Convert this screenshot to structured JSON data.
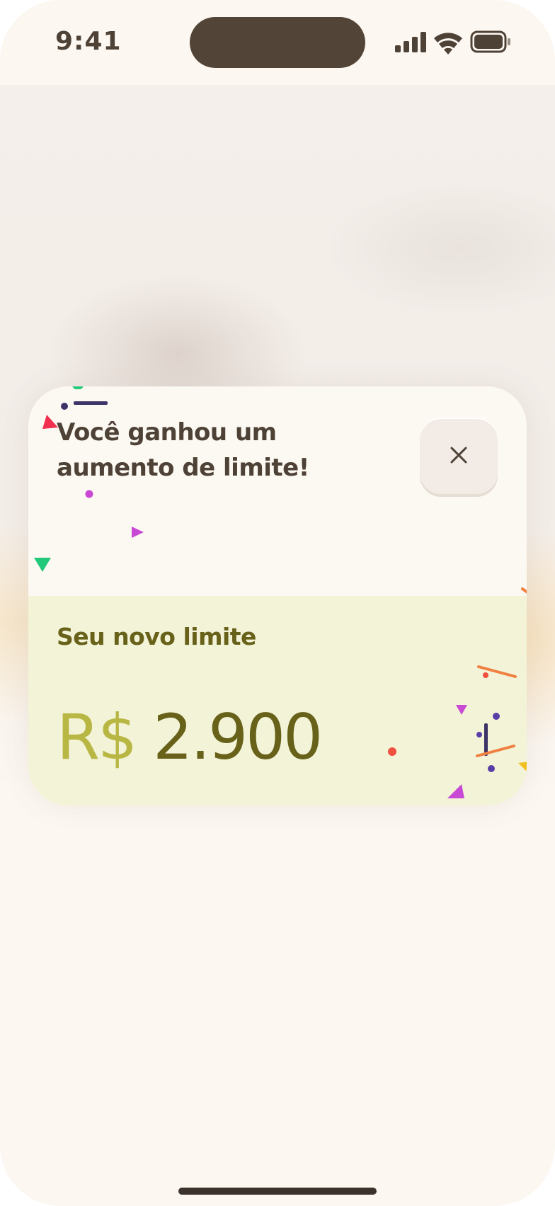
{
  "status_bar": {
    "time": "9:41"
  },
  "modal": {
    "title": "Você ganhou um aumento de limite!",
    "close_icon": "close-icon",
    "limit_label": "Seu novo limite",
    "currency": "R$",
    "amount": "2.900"
  },
  "colors": {
    "background": "#fcf7f1",
    "title_text": "#4e4237",
    "limit_panel": "#f3f3d8",
    "limit_text": "#676119",
    "currency_text": "#b9b743"
  }
}
